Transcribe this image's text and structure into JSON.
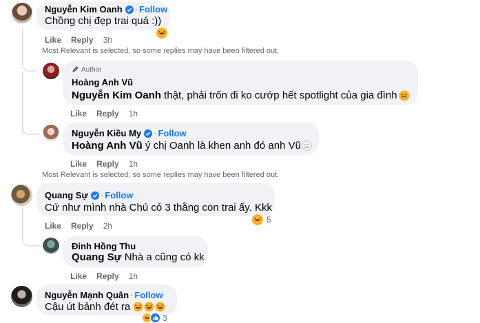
{
  "comments": [
    {
      "name": "Nguyễn Kim Oanh",
      "follow": "Follow",
      "text": "Chồng chị đẹp trai quá :))",
      "like": "Like",
      "reply": "Reply",
      "time": "3h"
    },
    {
      "author_tag": "Author",
      "name": "Hoàng Anh Vũ",
      "mention": "Nguyễn Kim Oanh",
      "text": " thật, phải trốn đi ko cướp hết spotlight của gia đình",
      "like": "Like",
      "reply": "Reply",
      "time": "1h"
    },
    {
      "name": "Nguyễn Kiều My",
      "follow": "Follow",
      "mention": "Hoàng Anh Vũ",
      "text": " ý chị Oanh là khen anh đó anh Vũ",
      "like": "Like",
      "reply": "Reply",
      "time": "1h"
    },
    {
      "name": "Quang Sự",
      "follow": "Follow",
      "text": "Cứ như mình nhà Chú có 3 thằng con trai ấy. Kkk",
      "like": "Like",
      "reply": "Reply",
      "time": "2h",
      "reaction_count": "5"
    },
    {
      "name": "Đinh Hồng Thu",
      "mention": "Quang Sự",
      "text": " Nhà a cũng có kk",
      "like": "Like",
      "reply": "Reply",
      "time": "1h"
    },
    {
      "name": "Nguyễn Mạnh Quân",
      "follow": "Follow",
      "text": "Cậu út bảnh đét ra",
      "reaction_count": "3"
    }
  ],
  "filter_notice": "Most Relevant is selected, so some replies may have been filtered out.",
  "colors": {
    "accent": "#1877f2",
    "bubble": "#f0f2f5",
    "muted": "#65676b"
  }
}
